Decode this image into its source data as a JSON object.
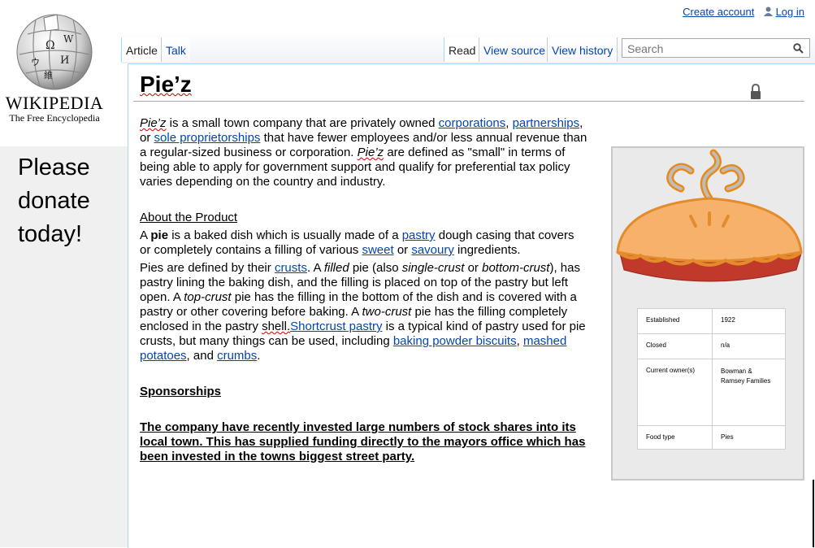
{
  "logo": {
    "wordmark": "Wikipedia",
    "tagline": "The Free Encyclopedia"
  },
  "sidebar": {
    "donate_text": "Please donate today!"
  },
  "personal": {
    "create_account": "Create account",
    "log_in": "Log in"
  },
  "tabs": {
    "article": "Article",
    "talk": "Talk",
    "read": "Read",
    "view_source": "View source",
    "view_history": "View history"
  },
  "search": {
    "placeholder": "Search"
  },
  "page": {
    "title": "Pie’z",
    "intro": {
      "t1": "Pie’z",
      "t2": " is a small town company that are privately owned ",
      "l1": "corporations",
      "t3": ", ",
      "l2": "partnerships",
      "t4": ", or ",
      "l3": "sole proprietorships",
      "t5": " that have fewer employees and/or less annual revenue than a regular-sized business or corporation. ",
      "t6": "Pie’z",
      "t7": " are defined as \"small\" in terms of being able to apply for government support and qualify for preferential tax policy varies depending on the country and industry."
    },
    "about_heading": "About the Product",
    "product": {
      "t1": "A ",
      "t2": "pie",
      "t3": " is a baked dish which is usually made of a ",
      "l1": "pastry",
      "t4": " dough casing that covers or completely contains a filling of various ",
      "l2": "sweet",
      "t5": " or ",
      "l3": "savoury",
      "t6": " ingredients."
    },
    "pies": {
      "t1": "Pies are defined by their ",
      "l1": "crusts",
      "t2": ". A ",
      "i1": "filled",
      "t3": " pie (also ",
      "i2": "single-crust",
      "t4": " or ",
      "i3": "bottom-crust",
      "t5": "), has pastry lining the baking dish, and the filling is placed on top of the pastry but left open. A ",
      "i4": "top-crust",
      "t6": " pie has the filling in the bottom of the dish and is covered with a pastry or other covering before baking. A ",
      "i5": "two-crust",
      "t7": " pie has the filling completely enclosed in the pastry ",
      "w1": "shell.",
      "l2": "Shortcrust pastry",
      "t8": " is a typical kind of pastry used for pie crusts, but many things can be used, including ",
      "l3": "baking powder biscuits",
      "t9": ", ",
      "l4": "mashed potatoes",
      "t10": ", and ",
      "l5": "crumbs",
      "t11": "."
    },
    "sponsorships_heading": "Sponsorships",
    "sponsorships_text": "The company have recently invested large numbers of stock shares into its local town. This has supplied funding directly to the mayors office which has been invested in the towns biggest street party."
  },
  "infobox": {
    "rows": [
      {
        "key": "Established",
        "value": "1922"
      },
      {
        "key": "Closed",
        "value": "n/a"
      },
      {
        "key": "Current owner(s)",
        "value": "Bowman & Ramsey Families"
      },
      {
        "key": "Food type",
        "value": "Pies"
      }
    ]
  },
  "colors": {
    "link": "#0645ad",
    "sidebar_bg": "#f0f0f0",
    "pie_filling": "#c0392b",
    "pie_crust": "#f4a460",
    "steam": "#e67e22"
  },
  "icons": [
    "wikipedia-globe-icon",
    "user-icon",
    "search-icon",
    "lock-icon",
    "pie-image"
  ]
}
